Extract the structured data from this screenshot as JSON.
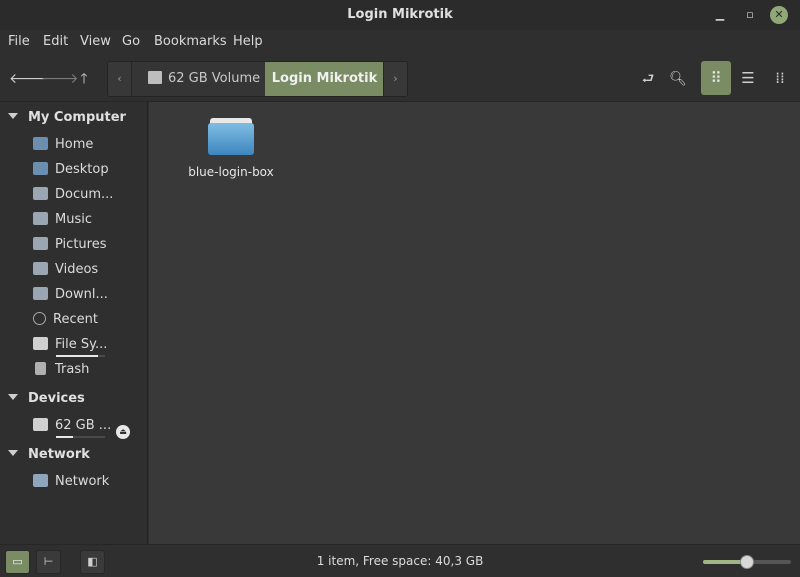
{
  "window": {
    "title": "Login Mikrotik"
  },
  "menu": {
    "file": "File",
    "edit": "Edit",
    "view": "View",
    "go": "Go",
    "bookmarks": "Bookmarks",
    "help": "Help"
  },
  "toolbar": {
    "breadcrumbs": [
      {
        "label": "62 GB Volume",
        "icon": "drive-icon",
        "active": false
      },
      {
        "label": "Login Mikrotik",
        "icon": "",
        "active": true
      }
    ],
    "view_mode": "icons"
  },
  "sidebar": {
    "sections": [
      {
        "title": "My Computer",
        "items": [
          {
            "label": "Home",
            "icon": "home-folder-icon"
          },
          {
            "label": "Desktop",
            "icon": "desktop-icon"
          },
          {
            "label": "Docum...",
            "icon": "documents-folder-icon"
          },
          {
            "label": "Music",
            "icon": "music-folder-icon"
          },
          {
            "label": "Pictures",
            "icon": "pictures-folder-icon"
          },
          {
            "label": "Videos",
            "icon": "videos-folder-icon"
          },
          {
            "label": "Downl...",
            "icon": "downloads-folder-icon"
          },
          {
            "label": "Recent",
            "icon": "recent-icon"
          },
          {
            "label": "File Sy...",
            "icon": "filesystem-icon",
            "usage": 0.85
          },
          {
            "label": "Trash",
            "icon": "trash-icon"
          }
        ]
      },
      {
        "title": "Devices",
        "items": [
          {
            "label": "62 GB ...",
            "icon": "drive-icon",
            "usage": 0.35,
            "eject": true
          }
        ]
      },
      {
        "title": "Network",
        "items": [
          {
            "label": "Network",
            "icon": "network-icon"
          }
        ]
      }
    ]
  },
  "files": [
    {
      "name": "blue-login-box",
      "type": "folder",
      "icon": "folder-icon"
    }
  ],
  "status": {
    "text": "1 item, Free space: 40,3 GB",
    "zoom": 0.5
  },
  "colors": {
    "accent": "#7a8c64",
    "folder_blue": "#4a90c8"
  }
}
